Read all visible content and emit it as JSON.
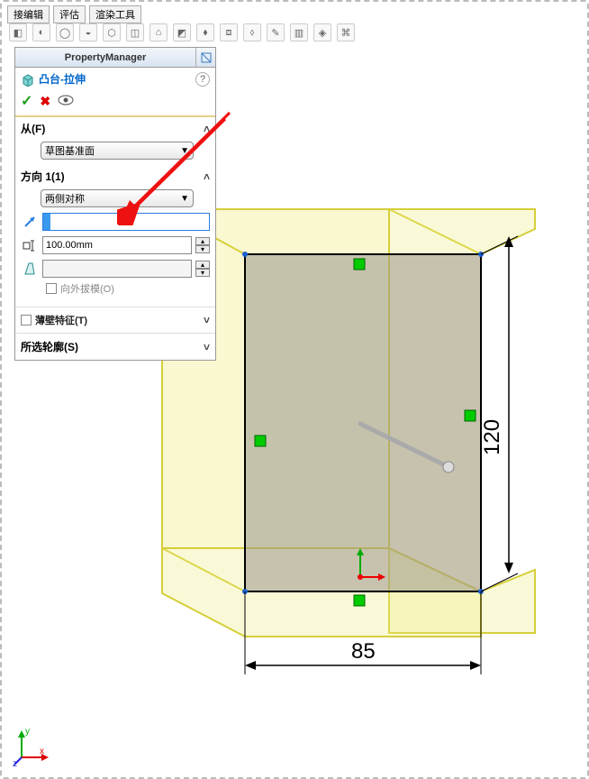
{
  "tabs": [
    "接编辑",
    "评估",
    "渲染工具"
  ],
  "pm": {
    "title": "PropertyManager",
    "feature": "凸台-拉伸",
    "help": "?",
    "sections": {
      "from": {
        "label": "从(F)",
        "option": "草图基准面"
      },
      "dir1": {
        "label": "方向 1(1)",
        "option": "两侧对称",
        "depth": "100.00mm",
        "draft_outward": "向外拔模(O)"
      },
      "thin": "薄壁特征(T)",
      "contour": "所选轮廓(S)"
    }
  },
  "dims": {
    "w": "85",
    "h": "120"
  },
  "coord": {
    "x": "x",
    "y": "y",
    "z": "z"
  }
}
